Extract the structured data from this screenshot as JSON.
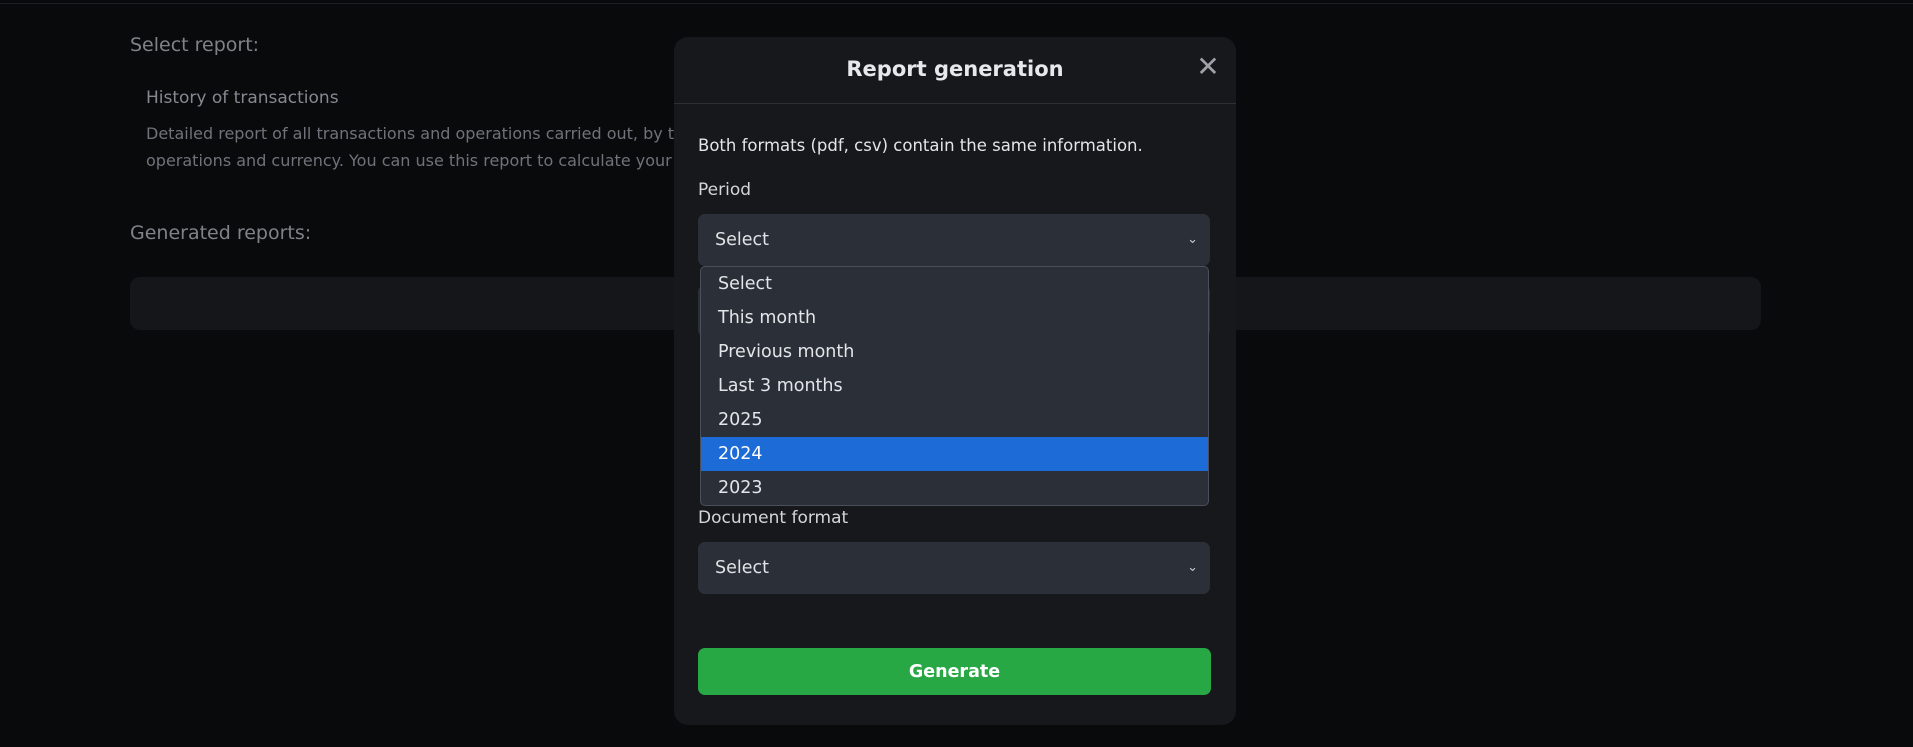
{
  "page": {
    "select_report_label": "Select report:",
    "report": {
      "name": "History of transactions",
      "description_line1": "Detailed report of all transactions and operations carried out, by t",
      "description_line2": "operations and currency. You can use this report to calculate your"
    },
    "generated_reports_label": "Generated reports:"
  },
  "modal": {
    "title": "Report generation",
    "close_icon": "close-icon",
    "info": "Both formats (pdf, csv) contain the same information.",
    "period_label": "Period",
    "period_value": "Select",
    "period_options": [
      "Select",
      "This month",
      "Previous month",
      "Last 3 months",
      "2025",
      "2024",
      "2023"
    ],
    "period_highlighted": "2024",
    "document_format_label": "Document format",
    "document_format_value": "Select",
    "generate_label": "Generate"
  },
  "colors": {
    "background": "#090a0c",
    "modal": "#16181c",
    "field": "#2b3038",
    "highlight": "#1d6bd6",
    "accent_green": "#27a844"
  }
}
